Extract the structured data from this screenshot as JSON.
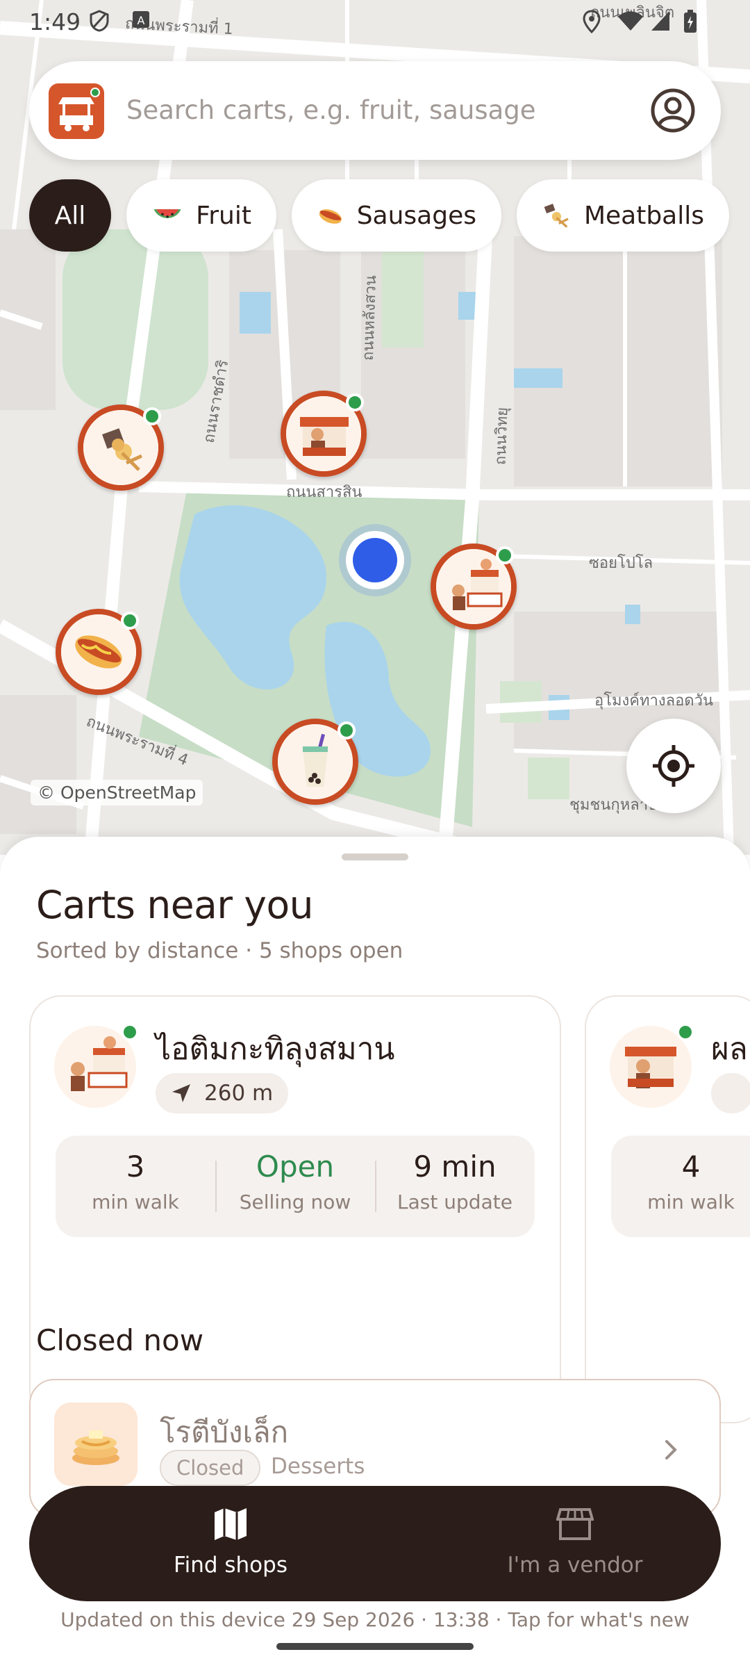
{
  "status_bar": {
    "time": "1:49"
  },
  "search": {
    "placeholder": "Search carts, e.g. fruit, sausage"
  },
  "filters": [
    {
      "label": "All",
      "active": true
    },
    {
      "label": "Fruit",
      "icon": "watermelon-icon"
    },
    {
      "label": "Sausages",
      "icon": "hotdog-icon"
    },
    {
      "label": "Meatballs",
      "icon": "skewer-icon"
    }
  ],
  "map": {
    "attribution": "© OpenStreetMap",
    "street_labels": [
      "ถนนสารสิน",
      "ซอยโปโล",
      "ถนนพระรามที่ 4",
      "อุโมงค์ทางลอดวัน",
      "ชุมชนกุหลาบ",
      "ถนนราชดำริ",
      "ถนนหลังสวน",
      "ถนนวิทยุ",
      "ถนนพระรามที่ 1",
      "ถนนเพลินจิต"
    ]
  },
  "nearby": {
    "title": "Carts near you",
    "subtitle": "Sorted by distance · 5 shops open",
    "cards": [
      {
        "name": "ไอติมกะทิลุงสมาน",
        "distance": "260 m",
        "stats": [
          {
            "value": "3",
            "label": "min walk"
          },
          {
            "value": "Open",
            "label": "Selling now"
          },
          {
            "value": "9 min",
            "label": "Last update"
          }
        ]
      },
      {
        "name": "ผล",
        "stats": [
          {
            "value": "4",
            "label": "min walk"
          }
        ]
      }
    ]
  },
  "closed": {
    "title": "Closed now",
    "items": [
      {
        "name": "โรตีบังเล็ก",
        "badge": "Closed",
        "category": "Desserts"
      }
    ]
  },
  "nav": {
    "find_shops": "Find shops",
    "vendor": "I'm a vendor"
  },
  "footer": "Updated on this device 29 Sep 2026 · 13:38 · Tap for what's new",
  "colors": {
    "accent": "#c84b23",
    "dark": "#2b1d19",
    "live": "#2e9d4b",
    "open_text": "#2e8b4f"
  }
}
